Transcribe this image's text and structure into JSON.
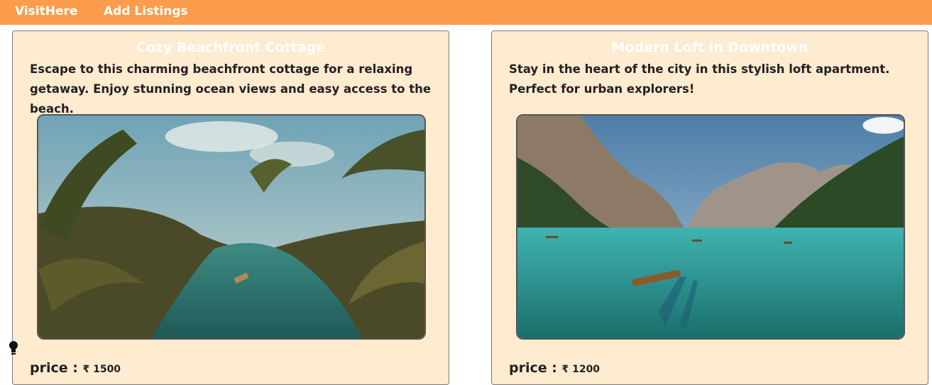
{
  "navbar": {
    "brand": "VisitHere",
    "add_listings": "Add Listings",
    "background": "#fb9d4d"
  },
  "listings": [
    {
      "title": "Cozy Beachfront Cottage",
      "description": "Escape to this charming beachfront cottage for a relaxing getaway. Enjoy stunning ocean views and easy access to the beach.",
      "price_label": "price : ",
      "price_value": "₹ 1500"
    },
    {
      "title": "Modern Loft in Downtown",
      "description": "Stay in the heart of the city in this stylish loft apartment. Perfect for urban explorers!",
      "price_label": "price : ",
      "price_value": "₹ 1200"
    }
  ],
  "icons": {
    "cursor": "lightbulb-icon"
  },
  "colors": {
    "card_bg": "#ffebd0",
    "title_text": "#ffffff"
  }
}
